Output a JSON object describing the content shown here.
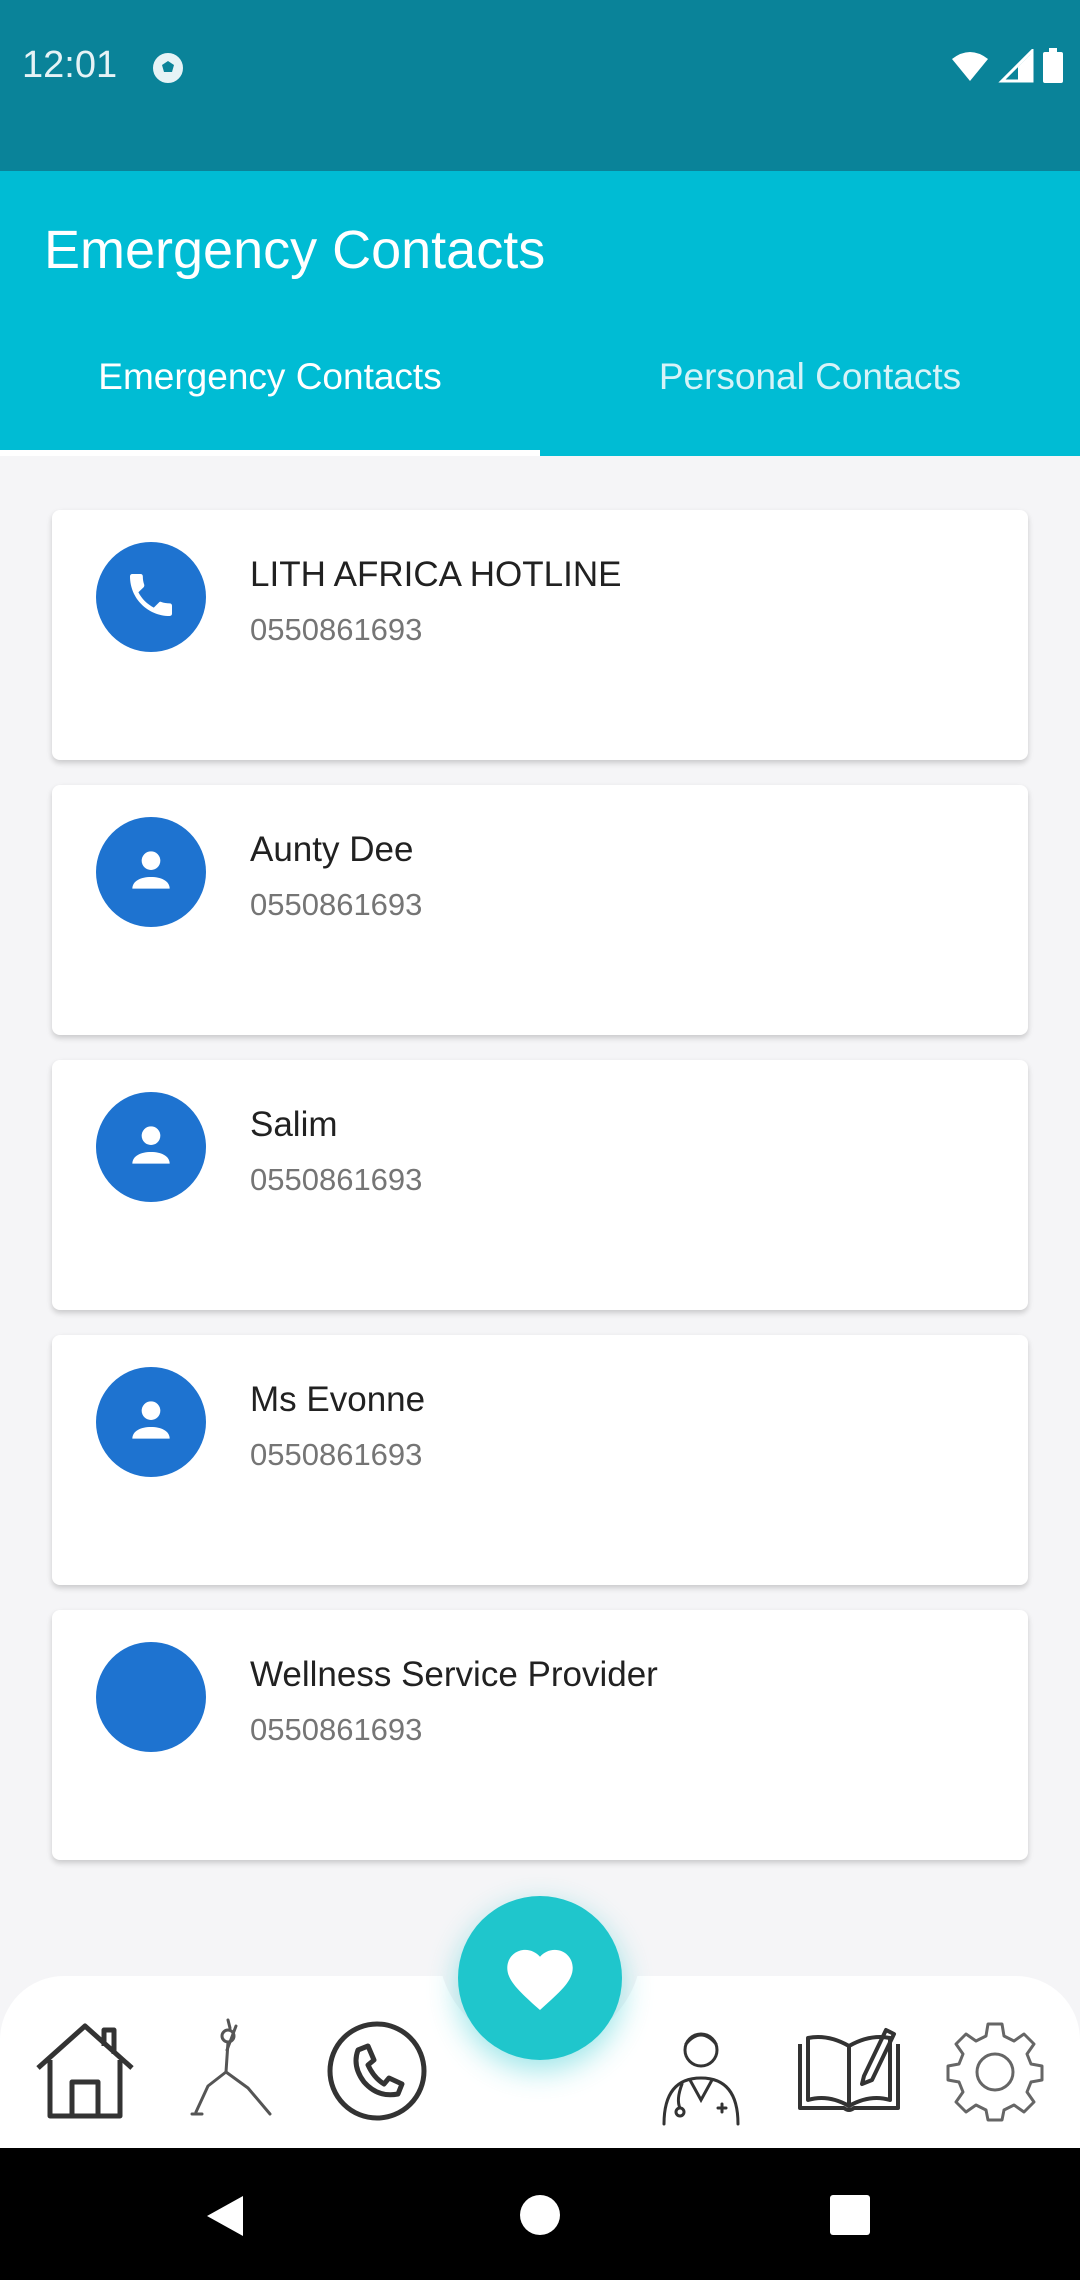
{
  "status_bar": {
    "time": "12:01"
  },
  "app_bar": {
    "title": "Emergency Contacts"
  },
  "tabs": [
    {
      "label": "Emergency Contacts",
      "active": true
    },
    {
      "label": "Personal Contacts",
      "active": false
    }
  ],
  "contacts": [
    {
      "name": "LITH AFRICA HOTLINE",
      "number": "0550861693",
      "icon": "phone-icon"
    },
    {
      "name": "Aunty Dee",
      "number": "0550861693",
      "icon": "person-icon"
    },
    {
      "name": "Salim",
      "number": "0550861693",
      "icon": "person-icon"
    },
    {
      "name": "Ms Evonne",
      "number": "0550861693",
      "icon": "person-icon"
    },
    {
      "name": "Wellness Service Provider",
      "number": "0550861693",
      "icon": "none"
    }
  ],
  "bottom_nav": {
    "items": [
      "home-icon",
      "yoga-icon",
      "phone-call-icon",
      "doctor-icon",
      "journal-icon",
      "settings-icon"
    ],
    "fab_icon": "heart-icon"
  },
  "colors": {
    "status_bar": "#0a8399",
    "app_bar": "#00bcd4",
    "avatar": "#1e73d0",
    "fab": "#1fc6cc"
  }
}
